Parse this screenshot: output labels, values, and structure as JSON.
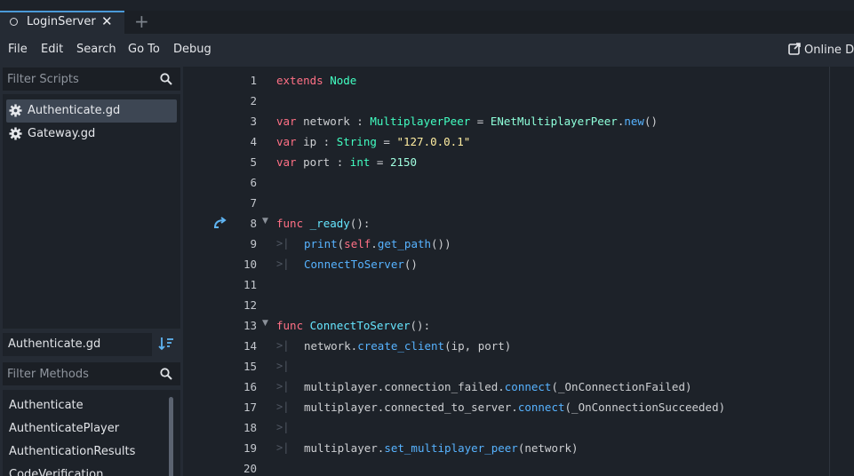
{
  "tabbar": {
    "tab_label": "LoginServer",
    "close_glyph": "✕",
    "add_glyph": "+"
  },
  "menu": {
    "file": "File",
    "edit": "Edit",
    "search": "Search",
    "goto": "Go To",
    "debug": "Debug",
    "online_docs": "Online Do"
  },
  "scripts": {
    "filter_placeholder": "Filter Scripts",
    "items": [
      {
        "label": "Authenticate.gd",
        "selected": true
      },
      {
        "label": "Gateway.gd",
        "selected": false
      }
    ]
  },
  "current_file": "Authenticate.gd",
  "methods": {
    "filter_placeholder": "Filter Methods",
    "items": [
      "Authenticate",
      "AuthenticatePlayer",
      "AuthenticationResults",
      "CodeVerification"
    ]
  },
  "editor": {
    "lines": [
      {
        "n": "1"
      },
      {
        "n": "2"
      },
      {
        "n": "3"
      },
      {
        "n": "4"
      },
      {
        "n": "5"
      },
      {
        "n": "6"
      },
      {
        "n": "7"
      },
      {
        "n": "8"
      },
      {
        "n": "9"
      },
      {
        "n": "10"
      },
      {
        "n": "11"
      },
      {
        "n": "12"
      },
      {
        "n": "13"
      },
      {
        "n": "14"
      },
      {
        "n": "15"
      },
      {
        "n": "16"
      },
      {
        "n": "17"
      },
      {
        "n": "18"
      },
      {
        "n": "19"
      },
      {
        "n": "20"
      }
    ]
  },
  "colors": {
    "accent": "#4b9ad8",
    "keyword": "#ff7085",
    "type": "#42ffc2",
    "string": "#ffeda1",
    "function": "#57b3ff"
  },
  "icons": [
    "scene-icon",
    "close-icon",
    "add-tab-icon",
    "external-link-icon",
    "search-icon",
    "gear-icon",
    "sort-icon",
    "override-arrow-icon",
    "fold-chevron-icon"
  ]
}
